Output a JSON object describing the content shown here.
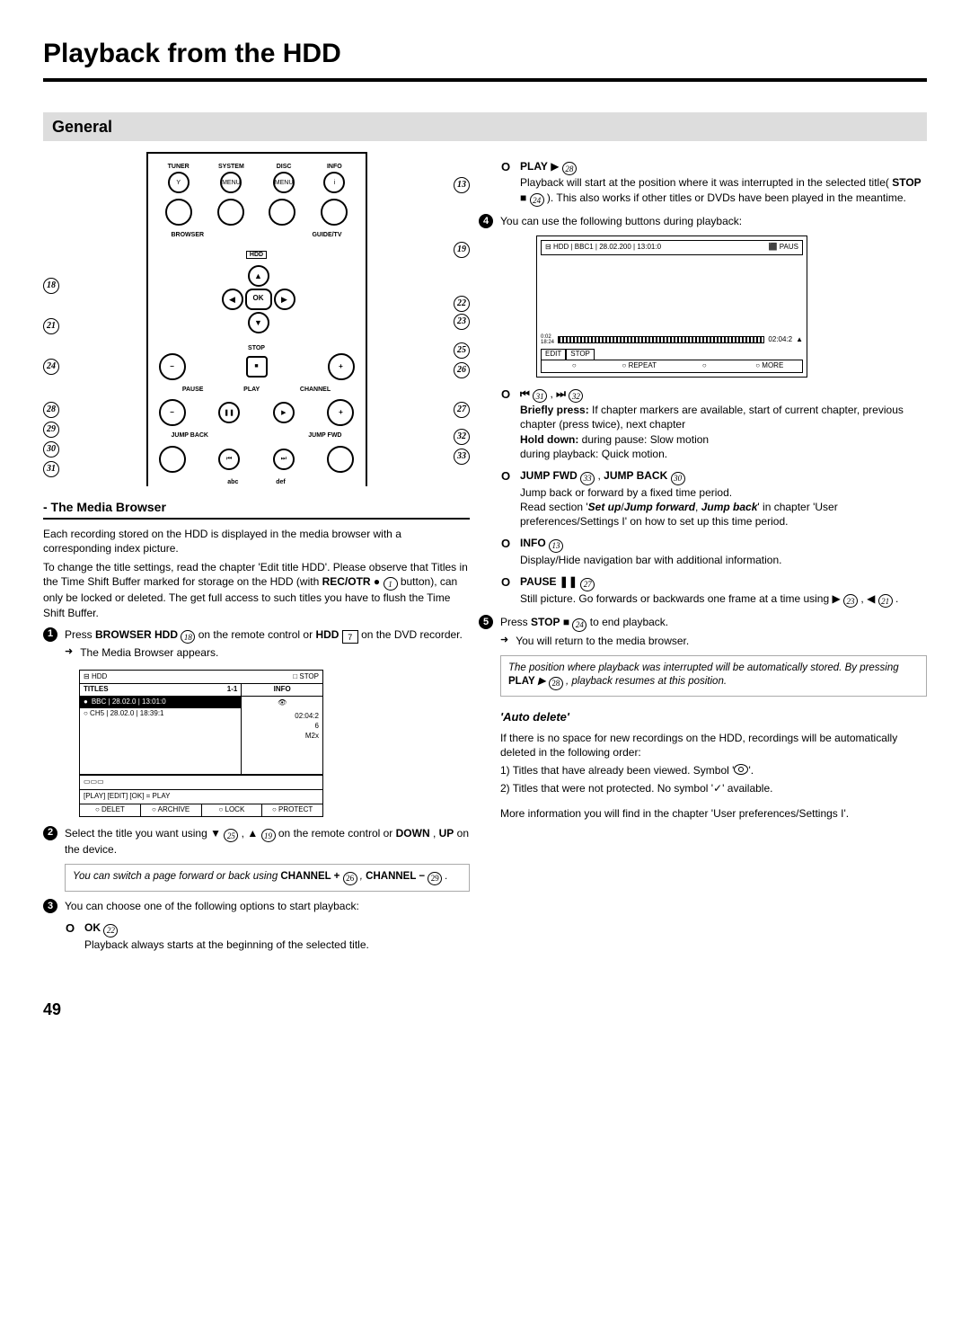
{
  "page": {
    "title": "Playback from the HDD",
    "section": "General",
    "number": "49"
  },
  "remote": {
    "row1_labels": [
      "TUNER",
      "SYSTEM",
      "DISC",
      "INFO"
    ],
    "row1_sub": [
      "",
      "MENU",
      "MENU",
      ""
    ],
    "browser_label": "BROWSER",
    "hdd_label": "HDD",
    "guide_label": "GUIDE/TV",
    "ok": "OK",
    "stop": "STOP",
    "pause": "PAUSE",
    "play": "PLAY",
    "channel": "CHANNEL",
    "jump_back": "JUMP BACK",
    "jump_fwd": "JUMP FWD",
    "abc": "abc",
    "def": "def"
  },
  "callouts": {
    "c13": "13",
    "c18": "18",
    "c19": "19",
    "c21": "21",
    "c22": "22",
    "c23": "23",
    "c24": "24",
    "c25": "25",
    "c26": "26",
    "c27": "27",
    "c28": "28",
    "c29": "29",
    "c30": "30",
    "c31": "31",
    "c32": "32",
    "c33": "33"
  },
  "media_browser": {
    "heading": "- The Media Browser",
    "p1": "Each recording stored on the HDD is displayed in the media browser with a corresponding index picture.",
    "p2a": "To change the title settings, read the chapter 'Edit title HDD'. Please observe that Titles in the Time Shift Buffer marked for storage on the HDD (with ",
    "p2b_bold": "REC/OTR",
    "p2c": " button), can only be locked or deleted. The get full access to such titles you have to flush the Time Shift Buffer.",
    "step1a": "Press ",
    "step1b_bold": "BROWSER HDD",
    "step1c": " on the remote control or ",
    "step1d_bold": "HDD",
    "step1e": " on the DVD recorder.",
    "step1_sub": "The Media Browser appears."
  },
  "screen1": {
    "top_left": "HDD",
    "top_right": "□ STOP",
    "titles": "TITLES",
    "titles_count": "1-1",
    "info": "INFO",
    "row1": "BBC | 28.02.0 | 13:01:0",
    "row2": "○ CH5 | 28.02.0 | 18:39:1",
    "info_time": "02:04:2",
    "info_rating": "6",
    "info_mode": "M2x",
    "tabs": "[PLAY] [EDIT] [OK] = PLAY",
    "btn1": "○ DELET",
    "btn2": "○ ARCHIVE",
    "btn3": "○ LOCK",
    "btn4": "○ PROTECT"
  },
  "step2": {
    "a": "Select the title you want using ",
    "b": " , ",
    "c": " on the remote control or ",
    "down": "DOWN",
    "comma": " , ",
    "up": "UP",
    "d": " on the device."
  },
  "tip1": {
    "a": "You can switch a page forward or back using ",
    "ch_plus": "CHANNEL +",
    "comma": " , ",
    "ch_minus": "CHANNEL −",
    "dot": " ."
  },
  "step3": "You can choose one of the following options to start playback:",
  "ok_item": {
    "title": "OK",
    "body": "Playback always starts at the beginning of the selected title."
  },
  "play_item": {
    "title": "PLAY",
    "b1": "Playback will start at the position where it was interrupted in the selected title( ",
    "stop": "STOP",
    "b2": " ). This also works if other titles or DVDs have been played in the meantime."
  },
  "step4": "You can use the following buttons during playback:",
  "screen2": {
    "top_left": "HDD | BBC1 | 28.02.200 | 13:01:0",
    "top_right": "⬛ PAUS",
    "prog_start_top": "0:02",
    "prog_start_bot": "18:24",
    "prog_end": "02:04:2",
    "tab1": "EDIT",
    "tab2": "STOP",
    "btn1": "○",
    "btn2": "○ REPEAT",
    "btn3": "○",
    "btn4": "○ MORE"
  },
  "skip_item": {
    "b1": "Briefly press:",
    "t1": " If chapter markers are available, start of current chapter, previous chapter (press twice), next chapter",
    "b2": "Hold down:",
    "t2": " during pause: Slow motion",
    "t3": "during playback: Quick motion."
  },
  "jump_item": {
    "title1": "JUMP FWD",
    "comma": " , ",
    "title2": "JUMP BACK",
    "l1": "Jump back or forward by a fixed time period.",
    "l2a": "Read section '",
    "l2b": "Set up",
    "l2slash": "/",
    "l2c": "Jump forward",
    "l2comma": ", ",
    "l2d": "Jump back",
    "l2e": "' in chapter 'User preferences/Settings I' on how to set up this time period."
  },
  "info_item": {
    "title": "INFO",
    "body": "Display/Hide navigation bar with additional information."
  },
  "pause_item": {
    "title": "PAUSE",
    "b1": "Still picture. Go forwards or backwards one frame at a time using ",
    "b2": " , ",
    "b3": " ."
  },
  "step5": {
    "a": "Press ",
    "stop": "STOP",
    "b": " to end playback.",
    "sub": "You will return to the media browser."
  },
  "tip2": {
    "a": "The position where playback was interrupted will be automatically stored. By pressing ",
    "play": "PLAY",
    "b": " , playback resumes at this position."
  },
  "auto_delete": {
    "heading": "'Auto delete'",
    "p1": "If there is no space for new recordings on the HDD, recordings will be automatically deleted in the following order:",
    "i1a": "1) Titles that have already been viewed. Symbol '",
    "i1b": "'.",
    "i2a": "2) Titles that were not protected. No symbol '",
    "i2b": "' available.",
    "p2": "More information you will find in the chapter 'User preferences/Settings I'."
  },
  "refs": {
    "r1": "1",
    "r7": "7",
    "r13": "13",
    "r18": "18",
    "r19": "19",
    "r21": "21",
    "r22": "22",
    "r23": "23",
    "r24": "24",
    "r25": "25",
    "r26": "26",
    "r27": "27",
    "r28": "28",
    "r29": "29",
    "r30": "30",
    "r31": "31",
    "r32": "32",
    "r33": "33"
  }
}
